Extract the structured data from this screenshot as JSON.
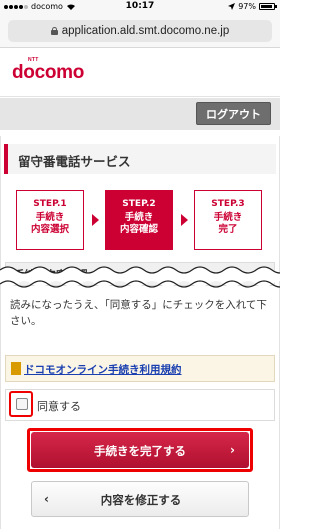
{
  "status_bar": {
    "carrier": "docomo",
    "time": "10:17",
    "battery": "97%",
    "signal_icon": "signal-dots-icon",
    "wifi_icon": "wifi-icon",
    "battery_icon": "battery-icon"
  },
  "browser": {
    "url": "application.ald.smt.docomo.ne.jp",
    "lock_icon": "lock-icon"
  },
  "header": {
    "logo_small": "NTT",
    "logo_text": "docomo",
    "brand_color": "#cc0033"
  },
  "toolbar": {
    "logout_label": "ログアウト"
  },
  "page": {
    "title": "留守番電話サービス"
  },
  "steps": [
    {
      "number": "STEP.1",
      "line1": "手続き",
      "line2": "内容選択",
      "active": false
    },
    {
      "number": "STEP.2",
      "line1": "手続き",
      "line2": "内容確認",
      "active": true
    },
    {
      "number": "STEP.3",
      "line1": "手続き",
      "line2": "完了",
      "active": false
    }
  ],
  "section": {
    "title": "手続き内容確認",
    "body_text": "読みになったうえ、「同意する」にチェックを入れて下さい。"
  },
  "terms": {
    "link_label": "ドコモオンライン手続き利用規約"
  },
  "agree": {
    "label": "同意する",
    "checked": false
  },
  "actions": {
    "complete_label": "手続きを完了する",
    "modify_label": "内容を修正する"
  },
  "colors": {
    "accent": "#cc0033",
    "highlight": "#ee0000",
    "link": "#1a3fb0"
  }
}
